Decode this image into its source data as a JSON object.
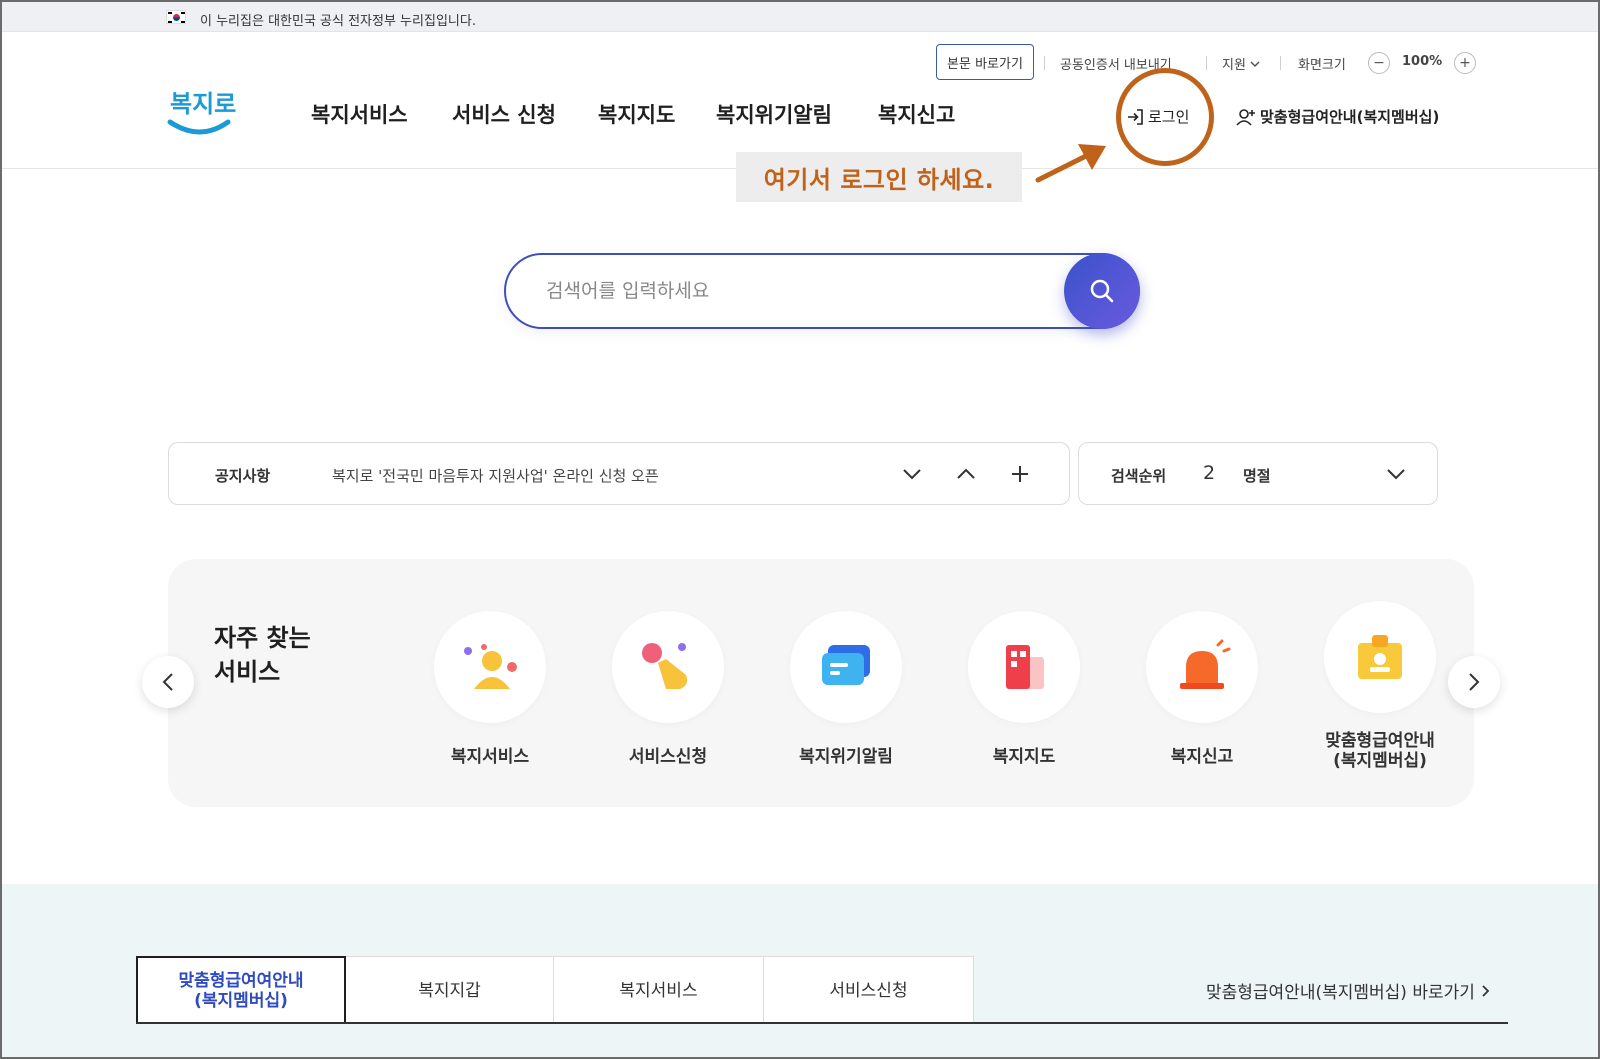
{
  "gov_banner": {
    "text": "이 누리집은 대한민국 공식 전자정부 누리집입니다."
  },
  "utility": {
    "skip_to_content": "본문 바로가기",
    "certificate": "공동인증서 내보내기",
    "support": "지원",
    "zoom_label": "화면크기",
    "zoom_minus": "−",
    "zoom_value": "100%",
    "zoom_plus": "+"
  },
  "header": {
    "logo_text": "복지로",
    "nav": [
      "복지서비스",
      "서비스 신청",
      "복지지도",
      "복지위기알림",
      "복지신고"
    ],
    "login": "로그인",
    "member_guide": "맞춤형급여안내(복지멤버십)"
  },
  "annotation": {
    "text": "여기서 로그인 하세요.",
    "color": "#c0621a"
  },
  "search": {
    "placeholder": "검색어를 입력하세요"
  },
  "notice": {
    "label": "공지사항",
    "text": "복지로 '전국민 마음투자 지원사업' 온라인 신청 오픈"
  },
  "rank": {
    "label": "검색순위",
    "number": "2",
    "word": "명절"
  },
  "frequent": {
    "title_line1": "자주 찾는",
    "title_line2": "서비스",
    "items": [
      {
        "label": "복지서비스",
        "icon": "people-icon"
      },
      {
        "label": "서비스신청",
        "icon": "hand-tap-icon"
      },
      {
        "label": "복지위기알림",
        "icon": "message-icon"
      },
      {
        "label": "복지지도",
        "icon": "building-icon"
      },
      {
        "label": "복지신고",
        "icon": "siren-icon"
      },
      {
        "label": "맞춤형급여안내\n(복지멤버십)",
        "icon": "id-card-icon"
      }
    ]
  },
  "tabs": {
    "items": [
      "맞춤형급여여안내\n(복지멤버십)",
      "복지지갑",
      "복지서비스",
      "서비스신청"
    ],
    "goto": "맞춤형급여안내(복지멤버십) 바로가기"
  },
  "colors": {
    "accent": "#3d4fb8",
    "annotation": "#c0621a",
    "tab_active": "#2f4bbf"
  }
}
